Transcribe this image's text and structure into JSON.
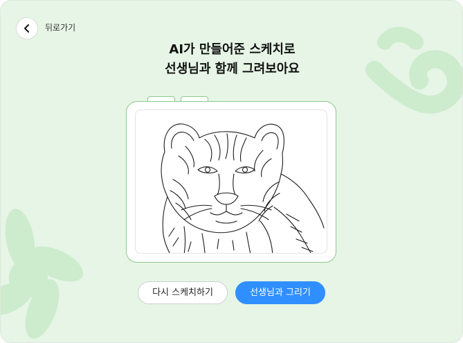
{
  "nav": {
    "back_label": "뒤로가기",
    "back_icon": "chevron-left-icon"
  },
  "heading": {
    "line1": "AI가 만들어준 스케치로",
    "line2": "선생님과 함께 그려보아요"
  },
  "sketch": {
    "subject": "tiger-sketch"
  },
  "actions": {
    "retry_label": "다시 스케치하기",
    "draw_label": "선생님과 그리기"
  },
  "colors": {
    "background": "#e6f5e5",
    "decor": "#cdebcd",
    "tablet_border": "#8cc98c",
    "primary": "#2f8fff"
  }
}
